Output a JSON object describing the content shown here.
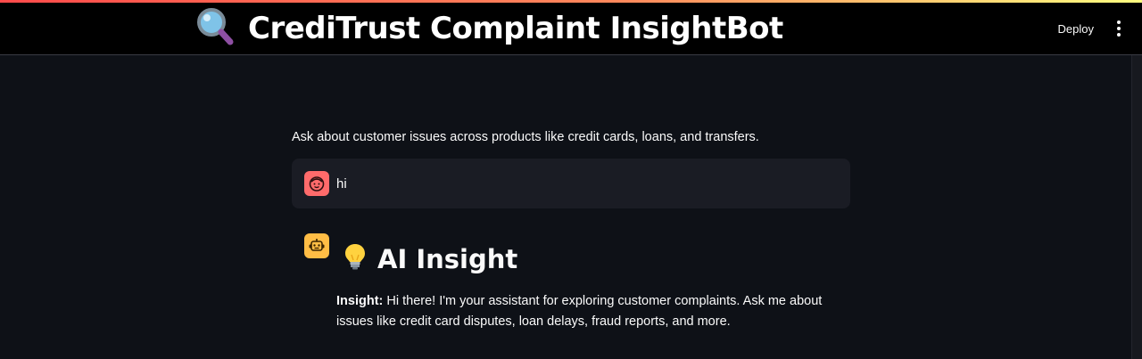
{
  "header": {
    "title": "CrediTrust Complaint InsightBot",
    "title_icon": "magnifying-glass-icon",
    "deploy_label": "Deploy",
    "menu_icon": "vertical-ellipsis-icon"
  },
  "main": {
    "intro": "Ask about customer issues across products like credit cards, loans, and transfers.",
    "messages": [
      {
        "role": "user",
        "avatar_icon": "user-face-icon",
        "avatar_color": "#ff6b6b",
        "text": "hi"
      },
      {
        "role": "assistant",
        "avatar_icon": "robot-icon",
        "avatar_color": "#ffbd45",
        "heading_icon": "lightbulb-icon",
        "heading": "AI Insight",
        "body_label": "Insight:",
        "body_text": " Hi there! I'm your assistant for exploring customer complaints. Ask me about issues like credit card disputes, loan delays, fraud reports, and more."
      }
    ]
  },
  "colors": {
    "background": "#0e1117",
    "header_background": "#000000",
    "user_message_background": "#1a1c24",
    "accent_gradient_start": "#ff4b4b",
    "accent_gradient_end": "#fffd80"
  }
}
